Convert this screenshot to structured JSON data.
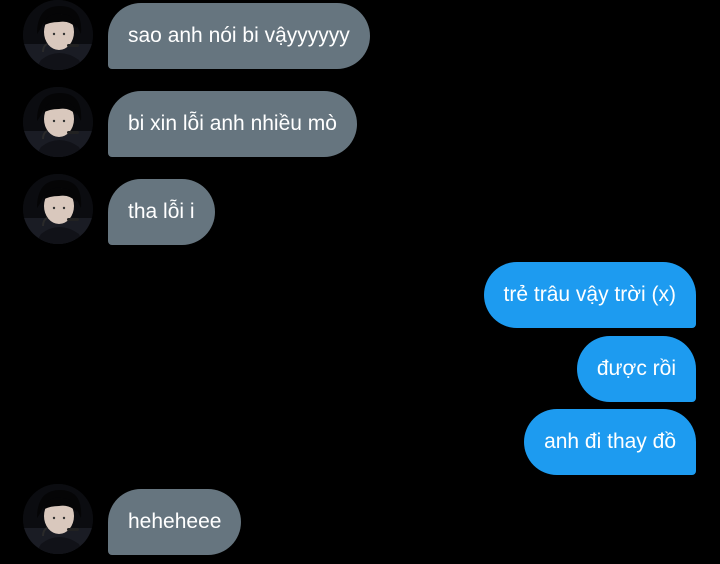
{
  "colors": {
    "background": "#000000",
    "incoming_bubble": "#66757f",
    "outgoing_bubble": "#1d9bf0",
    "bubble_text": "#ffffff"
  },
  "messages": [
    {
      "direction": "incoming",
      "text": "sao anh nói bi vậyyyyyy",
      "has_avatar": true
    },
    {
      "direction": "incoming",
      "text": "bi xin lỗi anh nhiều mò",
      "has_avatar": true
    },
    {
      "direction": "incoming",
      "text": "tha lỗi i",
      "has_avatar": true
    },
    {
      "direction": "outgoing",
      "text": "trẻ trâu vậy trời (x)",
      "has_avatar": false
    },
    {
      "direction": "outgoing",
      "text": "được rồi",
      "has_avatar": false
    },
    {
      "direction": "outgoing",
      "text": "anh đi thay đồ",
      "has_avatar": false
    },
    {
      "direction": "incoming",
      "text": "heheheee",
      "has_avatar": true
    }
  ]
}
